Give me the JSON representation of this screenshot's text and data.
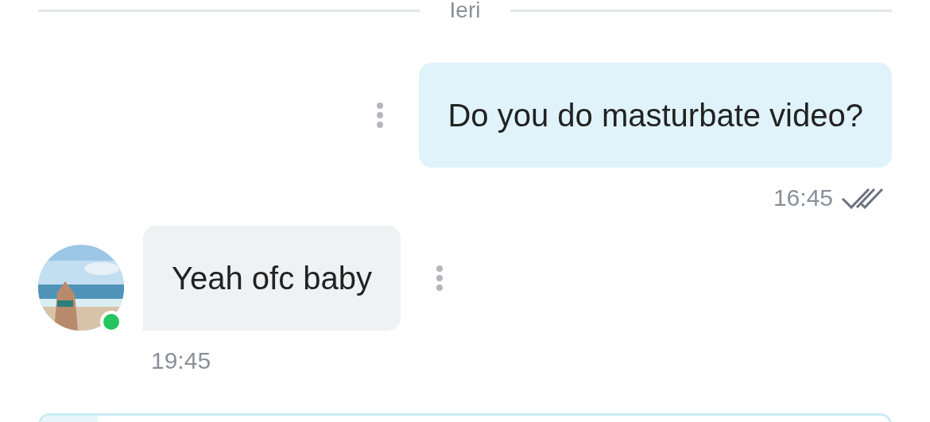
{
  "date_divider": {
    "label": "Ieri"
  },
  "messages": [
    {
      "kind": "sent",
      "text": "Do you do masturbate video?",
      "time": "16:45",
      "read": true
    },
    {
      "kind": "received",
      "text": "Yeah ofc baby",
      "time": "19:45",
      "online": true
    }
  ]
}
